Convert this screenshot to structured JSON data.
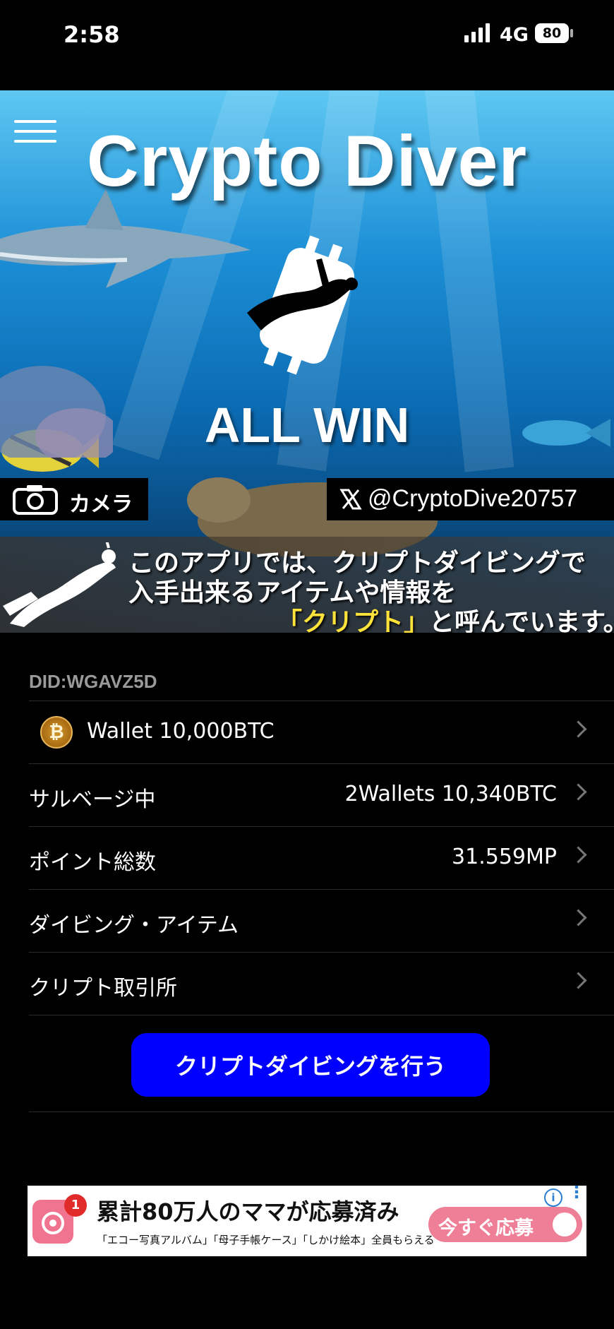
{
  "status_bar": {
    "time": "2:58",
    "network": "4G",
    "battery": "80"
  },
  "hero": {
    "title": "Crypto Diver",
    "tagline": "ALL WIN",
    "camera_label": "カメラ",
    "x_handle": "@CryptoDive20757",
    "note_line1": "このアプリでは、クリプトダイビングで",
    "note_line2": "入手出来るアイテムや情報を",
    "note_line3_highlight": "「クリプト」",
    "note_line3_rest": "と呼んでいます。"
  },
  "did": "DID:WGAVZ5D",
  "rows": [
    {
      "label": "Wallet 10,000BTC",
      "value": ""
    },
    {
      "label": "サルベージ中",
      "value": "2Wallets 10,340BTC"
    },
    {
      "label": "ポイント総数",
      "value": "31.559MP"
    },
    {
      "label": "ダイビング・アイテム",
      "value": ""
    },
    {
      "label": "クリプト取引所",
      "value": ""
    }
  ],
  "coin_symbol": "₿",
  "dive_button": "クリプトダイビングを行う",
  "ad": {
    "badge": "1",
    "headline": "累計80万人のママが応募済み",
    "sub": "「エコー写真アルバム」「母子手帳ケース」「しかけ絵本」全員もらえる",
    "cta": "今すぐ応募",
    "info": "i"
  },
  "icons": [
    "menu-icon",
    "camera-icon",
    "x-logo-icon",
    "bitcoin-coin-icon",
    "chevron-right-icon",
    "ad-info-icon",
    "ad-more-icon"
  ]
}
